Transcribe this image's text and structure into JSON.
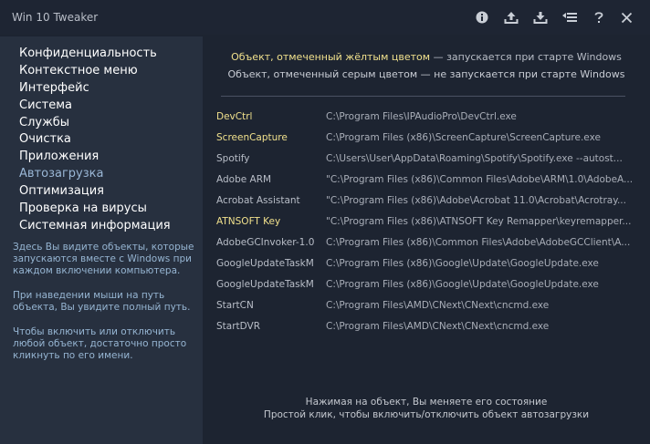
{
  "app": {
    "title": "Win 10 Tweaker"
  },
  "titlebar": {
    "buttons": [
      {
        "name": "info-icon"
      },
      {
        "name": "upload-icon"
      },
      {
        "name": "download-icon"
      },
      {
        "name": "list-icon"
      },
      {
        "name": "help-icon"
      },
      {
        "name": "close-icon"
      }
    ]
  },
  "sidebar": {
    "items": [
      {
        "label": "Конфиденциальность"
      },
      {
        "label": "Контекстное меню"
      },
      {
        "label": "Интерфейс"
      },
      {
        "label": "Система"
      },
      {
        "label": "Службы"
      },
      {
        "label": "Очистка"
      },
      {
        "label": "Приложения"
      },
      {
        "label": "Автозагрузка",
        "active": true
      },
      {
        "label": "Оптимизация"
      },
      {
        "label": "Проверка на вирусы"
      },
      {
        "label": "Системная информация"
      }
    ],
    "help": [
      "Здесь Вы видите объекты, которые запускаются вместе с Windows при каждом включении компьютера.",
      "При наведении мыши на путь объекта, Вы увидите полный путь.",
      "Чтобы включить или отключить любой объект, достаточно просто кликнуть по его имени."
    ]
  },
  "legend": {
    "line1_highlight": "Объект, отмеченный жёлтым цветом",
    "line1_rest": " — запускается при старте Windows",
    "line2": "Объект, отмеченный серым цветом  — не запускается при старте Windows"
  },
  "startup": [
    {
      "name": "DevCtrl",
      "path": "C:\\Program Files\\IPAudioPro\\DevCtrl.exe",
      "enabled": true
    },
    {
      "name": "ScreenCapture",
      "path": "C:\\Program Files (x86)\\ScreenCapture\\ScreenCapture.exe",
      "enabled": true
    },
    {
      "name": "Spotify",
      "path": "C:\\Users\\User\\AppData\\Roaming\\Spotify\\Spotify.exe --autost...",
      "enabled": false
    },
    {
      "name": "Adobe ARM",
      "path": "\"C:\\Program Files (x86)\\Common Files\\Adobe\\ARM\\1.0\\AdobeA...",
      "enabled": false
    },
    {
      "name": "Acrobat Assistant",
      "path": "\"C:\\Program Files (x86)\\Adobe\\Acrobat 11.0\\Acrobat\\Acrotray...",
      "enabled": false
    },
    {
      "name": "ATNSOFT Key",
      "path": "\"C:\\Program Files (x86)\\ATNSOFT Key Remapper\\keyremapper...",
      "enabled": true
    },
    {
      "name": "AdobeGCInvoker-1.0",
      "path": "C:\\Program Files (x86)\\Common Files\\Adobe\\AdobeGCClient\\A...",
      "enabled": false
    },
    {
      "name": "GoogleUpdateTaskM",
      "path": "C:\\Program Files (x86)\\Google\\Update\\GoogleUpdate.exe",
      "enabled": false
    },
    {
      "name": "GoogleUpdateTaskM",
      "path": "C:\\Program Files (x86)\\Google\\Update\\GoogleUpdate.exe",
      "enabled": false
    },
    {
      "name": "StartCN",
      "path": "C:\\Program Files\\AMD\\CNext\\CNext\\cncmd.exe",
      "enabled": false
    },
    {
      "name": "StartDVR",
      "path": "C:\\Program Files\\AMD\\CNext\\CNext\\cncmd.exe",
      "enabled": false
    }
  ],
  "footer": {
    "line1": "Нажимая на объект, Вы меняете его состояние",
    "line2": "Простой клик, чтобы включить/отключить объект автозагрузки"
  },
  "colors": {
    "enabled": "#f0e08c",
    "disabled": "#b9bec8",
    "active_nav": "#9ab7d6",
    "sidebar_bg": "#27303f",
    "main_bg": "#1d2431"
  }
}
